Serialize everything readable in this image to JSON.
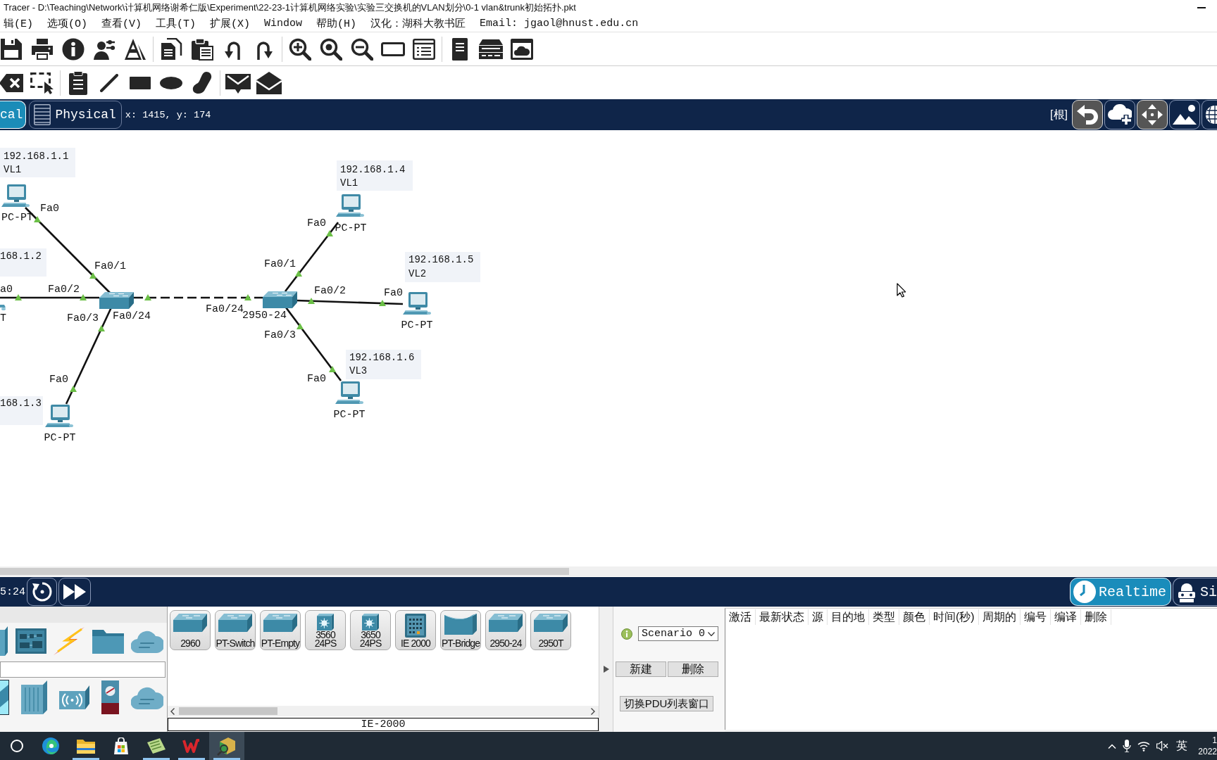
{
  "window": {
    "title": "Tracer - D:\\Teaching\\Network\\计算机网络谢希仁版\\Experiment\\22-23-1计算机网络实验\\实验三交换机的VLAN划分\\0-1 vlan&trunk初始拓扑.pkt"
  },
  "menu": [
    "辑(E)",
    "选项(O)",
    "查看(V)",
    "工具(T)",
    "扩展(X)",
    "Window",
    "帮助(H)",
    "汉化：湖科大教书匠",
    "Email: jgaol@hnust.edu.cn"
  ],
  "view_tabs": [
    {
      "label": "cal",
      "selected": true
    },
    {
      "label": "Physical",
      "selected": false
    }
  ],
  "pointer_position": "x: 1415, y: 174",
  "location": "[根]",
  "topology": {
    "devices": [
      {
        "kind": "pc",
        "label": "PC-PT",
        "note": [
          "192.168.1.1",
          "VL1"
        ]
      },
      {
        "kind": "pc",
        "label": "T",
        "note": [
          "168.1.2"
        ]
      },
      {
        "kind": "pc",
        "label": "PC-PT",
        "note": [
          "168.1.3"
        ]
      },
      {
        "kind": "switch"
      },
      {
        "kind": "switch",
        "label": "2950-24"
      },
      {
        "kind": "pc",
        "label": "PC-PT",
        "note": [
          "192.168.1.4",
          "VL1"
        ]
      },
      {
        "kind": "pc",
        "label": "PC-PT",
        "note": [
          "192.168.1.5",
          "VL2"
        ]
      },
      {
        "kind": "pc",
        "label": "PC-PT",
        "note": [
          "192.168.1.6",
          "VL3"
        ]
      }
    ],
    "links": [
      {
        "kind": "straight",
        "up": true,
        "ports": [
          "Fa0",
          "Fa0/1"
        ]
      },
      {
        "kind": "straight",
        "up": true,
        "ports": [
          "a0",
          "Fa0/2"
        ]
      },
      {
        "kind": "straight",
        "up": true,
        "ports": [
          "Fa0",
          "Fa0/3"
        ]
      },
      {
        "kind": "crossover",
        "up": true,
        "ports": [
          "Fa0/24",
          "Fa0/24"
        ]
      },
      {
        "kind": "straight",
        "up": true,
        "ports": [
          "Fa0/1",
          "Fa0"
        ]
      },
      {
        "kind": "straight",
        "up": true,
        "ports": [
          "Fa0/2",
          "Fa0"
        ]
      },
      {
        "kind": "straight",
        "up": true,
        "ports": [
          "Fa0/3",
          "Fa0"
        ]
      }
    ]
  },
  "sim_bar": {
    "clock": "5:24",
    "modes": [
      {
        "label": "Realtime",
        "selected": true
      },
      {
        "label": "Si",
        "selected": false
      }
    ]
  },
  "device_panel": {
    "categories": [
      {
        "selected": false
      },
      {
        "selected": false
      },
      {
        "selected": false
      },
      {
        "selected": false
      },
      {
        "selected": false
      }
    ],
    "subtypes": [
      {
        "selected": true
      },
      {
        "selected": false
      },
      {
        "selected": false
      },
      {
        "selected": false
      },
      {
        "selected": false
      }
    ],
    "models": [
      {
        "kind": "switch",
        "lines": [
          "2960"
        ]
      },
      {
        "kind": "switch",
        "lines": [
          "PT-Switch"
        ]
      },
      {
        "kind": "switch",
        "lines": [
          "PT-Empty"
        ]
      },
      {
        "kind": "multilayer",
        "lines": [
          "3560",
          "24PS"
        ]
      },
      {
        "kind": "multilayer",
        "lines": [
          "3650",
          "24PS"
        ]
      },
      {
        "kind": "industrial",
        "lines": [
          "IE 2000"
        ]
      },
      {
        "kind": "bridge",
        "lines": [
          "PT-Bridge"
        ]
      },
      {
        "kind": "switch",
        "lines": [
          "2950-24"
        ]
      },
      {
        "kind": "switch",
        "lines": [
          "2950T"
        ]
      }
    ],
    "status": "IE-2000"
  },
  "scenario": {
    "selected_scenario": "Scenario 0",
    "buttons": [
      "新建",
      "删除"
    ],
    "toggle_button": "切换PDU列表窗口"
  },
  "pdu_table": {
    "columns": [
      "激活",
      "最新状态",
      "源",
      "目的地",
      "类型",
      "颜色",
      "时间(秒)",
      "周期的",
      "编号",
      "编译",
      "删除"
    ]
  },
  "taskbar": {
    "apps": [
      {
        "running": false,
        "selected": false
      },
      {
        "running": true,
        "selected": false
      },
      {
        "running": false,
        "selected": false
      },
      {
        "running": true,
        "selected": false
      },
      {
        "running": true,
        "selected": false
      },
      {
        "running": true,
        "selected": true
      }
    ],
    "input_method": "英",
    "clock": [
      "1",
      "2022"
    ]
  }
}
